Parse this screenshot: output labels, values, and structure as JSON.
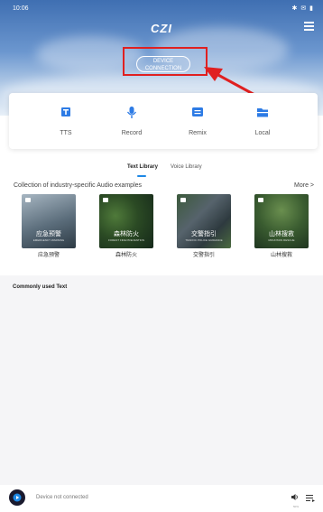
{
  "status_bar": {
    "time": "10:06",
    "icons": "✱ ✉ ▮"
  },
  "header": {
    "logo": "CZI"
  },
  "device_button": {
    "line1": "DEVICE",
    "line2": "CONNECTION"
  },
  "functions": [
    {
      "label": "TTS",
      "icon": "tts-icon"
    },
    {
      "label": "Record",
      "icon": "microphone-icon"
    },
    {
      "label": "Remix",
      "icon": "remix-icon"
    },
    {
      "label": "Local",
      "icon": "local-folder-icon"
    }
  ],
  "tabs": [
    {
      "label": "Text Library",
      "active": true
    },
    {
      "label": "Voice Library",
      "active": false
    }
  ],
  "collection": {
    "title": "Collection of industry-specific Audio examples",
    "more": "More >",
    "items": [
      {
        "overlay": "应急预警",
        "sub": "EMERGENCY WARNING",
        "caption": "应急预警"
      },
      {
        "overlay": "森林防火",
        "sub": "FOREST FIRE PREVENTION",
        "caption": "森林防火"
      },
      {
        "overlay": "交警指引",
        "sub": "TRAFFIC POLICE GUIDANCE",
        "caption": "交警指引"
      },
      {
        "overlay": "山林搜救",
        "sub": "MOUNTAIN RESCUE",
        "caption": "山林搜救"
      }
    ]
  },
  "common": {
    "title": "Commonly used Text"
  },
  "player": {
    "status": "Device not connected",
    "volume_label": "50%"
  },
  "colors": {
    "accent": "#1e88e5",
    "highlight": "#e02020"
  }
}
